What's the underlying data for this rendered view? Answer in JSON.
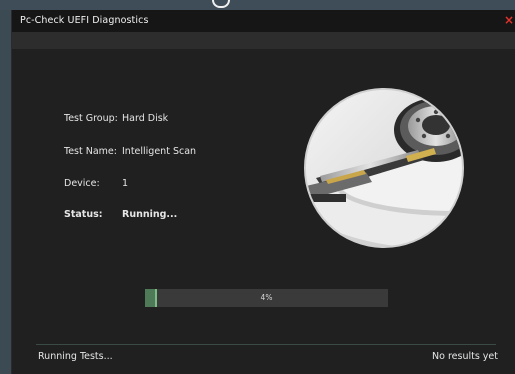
{
  "window": {
    "title": "Pc-Check UEFI Diagnostics",
    "close_glyph": "×"
  },
  "details": {
    "test_group_label": "Test Group:",
    "test_group_value": "Hard Disk",
    "test_name_label": "Test Name:",
    "test_name_value": "Intelligent Scan",
    "device_label": "Device:",
    "device_value": "1",
    "status_label": "Status:",
    "status_value": "Running..."
  },
  "image": {
    "icon": "hard-disk-photo"
  },
  "progress": {
    "percent_text": "4%",
    "fraction": 0.04
  },
  "footer": {
    "left_text": "Running Tests...",
    "right_text": "No results yet"
  },
  "colors": {
    "window_bg": "#202020",
    "titlebar_bg": "#161616",
    "close_red": "#e5322b",
    "progress_fill": "#4f7a58",
    "desktop_bg": "#3c4a54"
  }
}
